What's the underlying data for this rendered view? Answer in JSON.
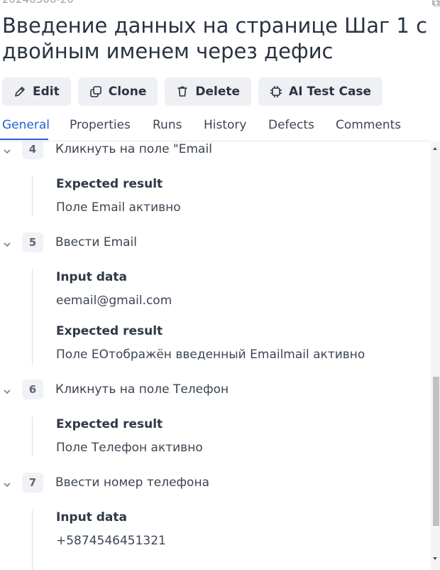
{
  "header": {
    "meta": "20240306-20",
    "title": "Введение данных на странице Шаг 1 с двойным именем через дефис"
  },
  "toolbar": {
    "edit": "Edit",
    "clone": "Clone",
    "delete": "Delete",
    "ai_test_case": "AI Test Case"
  },
  "tabs": [
    "General",
    "Properties",
    "Runs",
    "History",
    "Defects",
    "Comments"
  ],
  "active_tab": "General",
  "colors": {
    "accent": "#2563c9",
    "button_bg": "#eef0f3",
    "text": "#2c3340"
  },
  "steps": [
    {
      "number": "4",
      "title": "Кликнуть на поле \"Email",
      "expected_label": "Expected result",
      "expected": "Поле Email активно"
    },
    {
      "number": "5",
      "title": "Ввести Email",
      "input_label": "Input data",
      "input": "eemail@gmail.com",
      "expected_label": "Expected result",
      "expected": "Поле ЕОтображён введенный Emailmail активно"
    },
    {
      "number": "6",
      "title": "Кликнуть на поле Телефон",
      "expected_label": "Expected result",
      "expected": "Поле Телефон активно"
    },
    {
      "number": "7",
      "title": "Ввести номер телефона",
      "input_label": "Input data",
      "input": "+5874546451321"
    }
  ]
}
